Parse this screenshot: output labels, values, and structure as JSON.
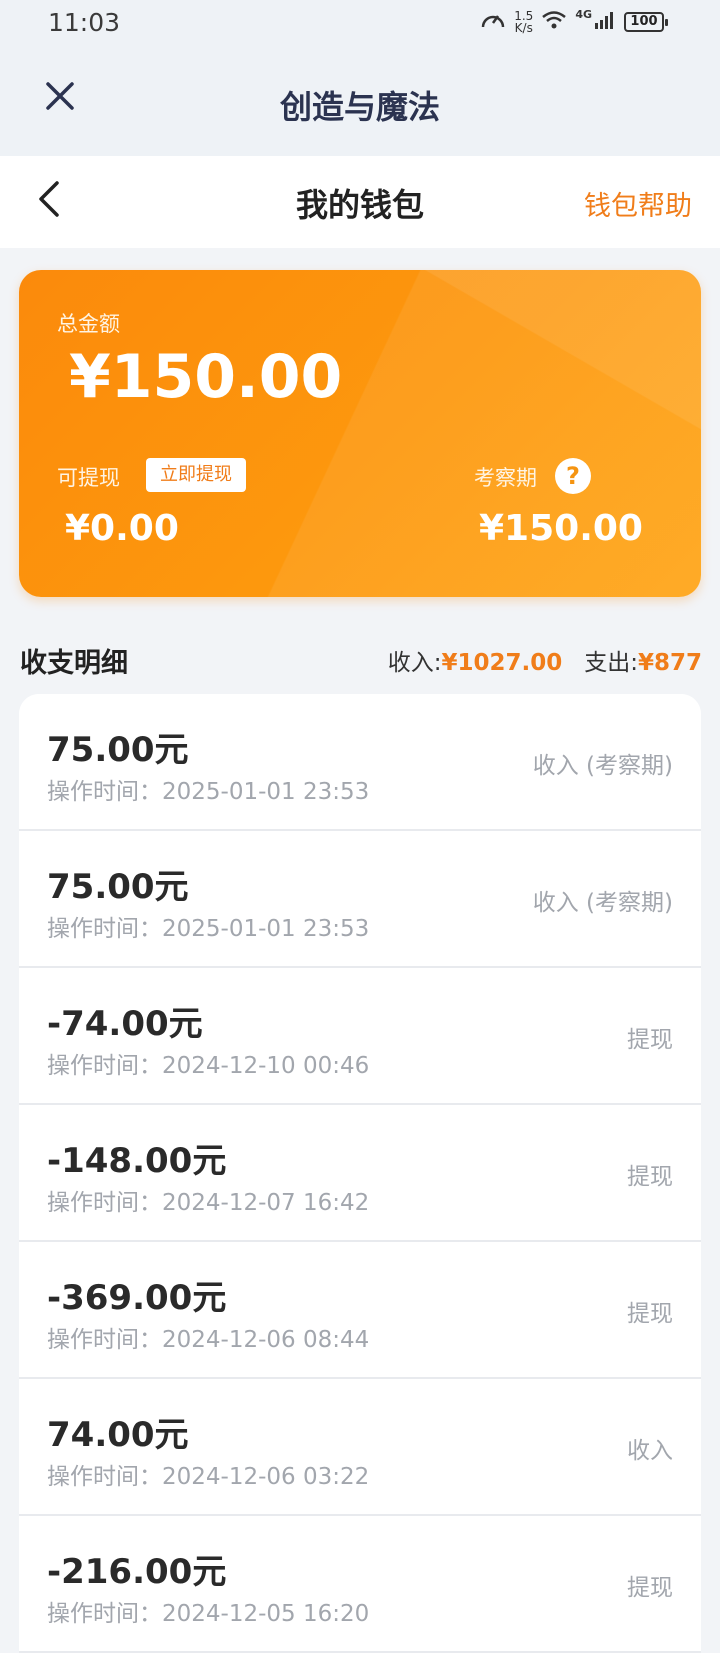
{
  "status_bar": {
    "time": "11:03",
    "net_speed_value": "1.5",
    "net_speed_unit": "K/s",
    "network": "4G",
    "battery": "100"
  },
  "app_header": {
    "title": "创造与魔法"
  },
  "nav": {
    "title": "我的钱包",
    "help_label": "钱包帮助"
  },
  "wallet": {
    "total_label": "总金额",
    "total_amount": "¥150.00",
    "withdrawable_label": "可提现",
    "withdraw_button": "立即提现",
    "withdrawable_amount": "¥0.00",
    "review_label": "考察期",
    "review_help_icon": "?",
    "review_amount": "¥150.00"
  },
  "details": {
    "title": "收支明细",
    "income_label": "收入:",
    "income_amount": "¥1027.00",
    "expense_label": "支出:",
    "expense_amount": "¥877"
  },
  "transactions": [
    {
      "amount": "75.00元",
      "time": "操作时间：2025-01-01 23:53",
      "type": "收入 (考察期)"
    },
    {
      "amount": "75.00元",
      "time": "操作时间：2025-01-01 23:53",
      "type": "收入 (考察期)"
    },
    {
      "amount": "-74.00元",
      "time": "操作时间：2024-12-10 00:46",
      "type": "提现"
    },
    {
      "amount": "-148.00元",
      "time": "操作时间：2024-12-07 16:42",
      "type": "提现"
    },
    {
      "amount": "-369.00元",
      "time": "操作时间：2024-12-06 08:44",
      "type": "提现"
    },
    {
      "amount": "74.00元",
      "time": "操作时间：2024-12-06 03:22",
      "type": "收入"
    },
    {
      "amount": "-216.00元",
      "time": "操作时间：2024-12-05 16:20",
      "type": "提现"
    }
  ],
  "colors": {
    "accent": "#f07d1a",
    "card_orange": "#fd980d",
    "header_bg": "#eef2f6"
  }
}
